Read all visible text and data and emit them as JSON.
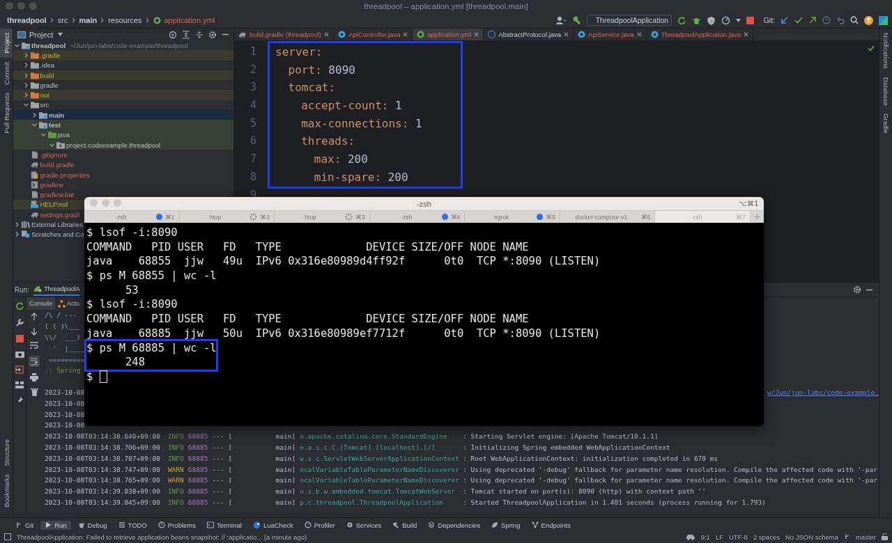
{
  "window": {
    "title": "threadpool – application.yml [threadpool.main]"
  },
  "breadcrumbs": [
    {
      "label": "threadpool",
      "untracked": false,
      "bold": true
    },
    {
      "label": "src",
      "untracked": false,
      "bold": false
    },
    {
      "label": "main",
      "untracked": false,
      "bold": true
    },
    {
      "label": "resources",
      "untracked": false,
      "bold": false
    },
    {
      "label": "application.yml",
      "untracked": true,
      "bold": false
    }
  ],
  "toolbar": {
    "run_config": "ThreadpoolApplication",
    "git_label": "Git:"
  },
  "left_stripe": {
    "top": [
      {
        "label": "Project",
        "selected": true
      },
      {
        "label": "Commit",
        "selected": false
      },
      {
        "label": "Pull Requests",
        "selected": false
      }
    ],
    "bottom": [
      {
        "label": "Structure",
        "selected": false
      },
      {
        "label": "Bookmarks",
        "selected": false
      }
    ]
  },
  "right_stripe": [
    {
      "label": "Notifications"
    },
    {
      "label": "Database"
    },
    {
      "label": "Gradle"
    }
  ],
  "project": {
    "title": "Project",
    "tree": [
      {
        "label": "threadpool",
        "hint": "~/Jun/jun-labs/code-example/threadpool",
        "kind": "module",
        "excluded": false,
        "untracked": false,
        "test_source": false,
        "selected": false,
        "expanded": true,
        "children": [
          {
            "label": ".gradle",
            "kind": "folder",
            "excluded": true,
            "untracked": false,
            "test_source": false,
            "selected": false,
            "expanded": false
          },
          {
            "label": ".idea",
            "kind": "folder",
            "excluded": false,
            "untracked": false,
            "test_source": false,
            "selected": false,
            "expanded": false
          },
          {
            "label": "build",
            "kind": "folder",
            "excluded": true,
            "untracked": false,
            "test_source": false,
            "selected": false,
            "expanded": false
          },
          {
            "label": "gradle",
            "kind": "folder",
            "excluded": false,
            "untracked": false,
            "test_source": false,
            "selected": false,
            "expanded": false
          },
          {
            "label": "out",
            "kind": "folder",
            "excluded": true,
            "untracked": false,
            "test_source": false,
            "selected": false,
            "expanded": false
          },
          {
            "label": "src",
            "kind": "folder",
            "excluded": false,
            "untracked": false,
            "test_source": false,
            "selected": false,
            "expanded": true,
            "children": [
              {
                "label": "main",
                "kind": "module",
                "excluded": false,
                "untracked": false,
                "test_source": false,
                "selected": true,
                "expanded": false
              },
              {
                "label": "test",
                "kind": "module",
                "excluded": false,
                "untracked": false,
                "test_source": true,
                "selected": false,
                "expanded": true,
                "children": [
                  {
                    "label": "java",
                    "kind": "test-folder",
                    "excluded": false,
                    "untracked": false,
                    "test_source": true,
                    "selected": false,
                    "expanded": true,
                    "children": [
                      {
                        "label": "project.codeexample.threadpool",
                        "kind": "package",
                        "excluded": false,
                        "untracked": false,
                        "test_source": true,
                        "selected": false,
                        "expanded": true
                      }
                    ]
                  }
                ]
              }
            ]
          },
          {
            "label": ".gitignore",
            "kind": "file",
            "excluded": false,
            "untracked": true,
            "test_source": false,
            "selected": false
          },
          {
            "label": "build.gradle",
            "kind": "gradle-file",
            "excluded": false,
            "untracked": true,
            "test_source": false,
            "selected": false
          },
          {
            "label": "gradle.properties",
            "kind": "properties-file",
            "excluded": false,
            "untracked": true,
            "test_source": false,
            "selected": false
          },
          {
            "label": "gradlew",
            "kind": "script-file",
            "excluded": false,
            "untracked": true,
            "test_source": false,
            "selected": false
          },
          {
            "label": "gradlew.bat",
            "kind": "file",
            "excluded": false,
            "untracked": true,
            "test_source": false,
            "selected": false
          },
          {
            "label": "HELP.md",
            "kind": "markdown-file",
            "excluded": true,
            "untracked": false,
            "test_source": false,
            "selected": false
          },
          {
            "label": "settings.gradl",
            "kind": "gradle-file",
            "excluded": false,
            "untracked": true,
            "test_source": false,
            "selected": false
          }
        ]
      },
      {
        "label": "External Libraries",
        "kind": "libraries",
        "excluded": false,
        "untracked": false,
        "test_source": false,
        "selected": false,
        "expanded": false
      },
      {
        "label": "Scratches and Co",
        "kind": "scratches",
        "excluded": false,
        "untracked": false,
        "test_source": false,
        "selected": false,
        "expanded": false
      }
    ]
  },
  "editor": {
    "tabs": [
      {
        "label": "build.gradle (threadpool)",
        "kind": "gradle",
        "untracked": true,
        "selected": false
      },
      {
        "label": "ApiController.java",
        "kind": "class",
        "untracked": true,
        "selected": false
      },
      {
        "label": "application.yml",
        "kind": "yaml",
        "untracked": true,
        "selected": true
      },
      {
        "label": "AbstractProtocol.java",
        "kind": "abstract",
        "untracked": false,
        "selected": false
      },
      {
        "label": "ApiService.java",
        "kind": "class",
        "untracked": true,
        "selected": false
      },
      {
        "label": "ThreadpoolApplication.java",
        "kind": "class",
        "untracked": true,
        "selected": false
      }
    ],
    "line_numbers": [
      "1",
      "2",
      "3",
      "4",
      "5",
      "6",
      "7",
      "8",
      "9"
    ],
    "highlighted": true,
    "code": [
      {
        "key": "server:",
        "children": [
          {
            "key": "port:",
            "value": "8090"
          },
          {
            "key": "tomcat:",
            "children": [
              {
                "key": "accept-count:",
                "value": "1"
              },
              {
                "key": "max-connections:",
                "value": "1"
              },
              {
                "key": "threads:",
                "children": [
                  {
                    "key": "max:",
                    "value": "200"
                  },
                  {
                    "key": "min-spare:",
                    "value": "200"
                  }
                ]
              }
            ]
          }
        ]
      }
    ]
  },
  "run": {
    "label": "Run:",
    "tab": "ThreadpoolA",
    "subtabs": [
      {
        "label": "Console",
        "selected": true
      },
      {
        "label": "Actu",
        "selected": false
      }
    ],
    "banner": [
      "/\\ / ---",
      "( ( )\\___",
      "\\\\/  ___)",
      "  '  |____",
      " =========",
      ":: Spring"
    ],
    "log": [
      {
        "time": "2023-10-08",
        "link": "w/Jun/jun-labs/code-example."
      },
      {
        "time": "2023-10-08"
      },
      {
        "time": "2023-10-08"
      },
      {
        "time": "2023-10-08"
      },
      {
        "time": "2023-10-08T03:14:38.640+09:00",
        "level": "INFO",
        "kind": "info",
        "pid": "68885",
        "dashes": "---",
        "open": "[",
        "thread": "main]",
        "logger": "o.apache.catalina.core.StandardEngine",
        "message": ": Starting Servlet engine: [Apache Tomcat/10.1.1]"
      },
      {
        "time": "2023-10-08T03:14:38.706+09:00",
        "level": "INFO",
        "kind": "info",
        "pid": "68885",
        "dashes": "---",
        "open": "[",
        "thread": "main]",
        "logger": "o.a.c.c.C.[Tomcat].[localhost].[/]",
        "message": ": Initializing Spring embedded WebApplicationContext"
      },
      {
        "time": "2023-10-08T03:14:38.707+09:00",
        "level": "INFO",
        "kind": "info",
        "pid": "68885",
        "dashes": "---",
        "open": "[",
        "thread": "main]",
        "logger": "w.s.c.ServletWebServerApplicationContext",
        "message": ": Root WebApplicationContext: initialization completed in 670 ms"
      },
      {
        "time": "2023-10-08T03:14:38.747+09:00",
        "level": "WARN",
        "kind": "warn",
        "pid": "68885",
        "dashes": "---",
        "open": "[",
        "thread": "main]",
        "logger": "ocalVariableTableParameterNameDiscoverer",
        "message": ": Using deprecated '-debug' fallback for parameter name resolution. Compile the affected code with '-par"
      },
      {
        "time": "2023-10-08T03:14:38.765+09:00",
        "level": "WARN",
        "kind": "warn",
        "pid": "68885",
        "dashes": "---",
        "open": "[",
        "thread": "main]",
        "logger": "ocalVariableTableParameterNameDiscoverer",
        "message": ": Using deprecated '-debug' fallback for parameter name resolution. Compile the affected code with '-par"
      },
      {
        "time": "2023-10-08T03:14:39.038+09:00",
        "level": "INFO",
        "kind": "info",
        "pid": "68885",
        "dashes": "---",
        "open": "[",
        "thread": "main]",
        "logger": "o.s.b.w.embedded.tomcat.TomcatWebServer",
        "message": ": Tomcat started on port(s): 8090 (http) with context path ''"
      },
      {
        "time": "2023-10-08T03:14:39.045+09:00",
        "level": "INFO",
        "kind": "info",
        "pid": "68885",
        "dashes": "---",
        "open": "[",
        "thread": "main]",
        "logger": "p.c.threadpool.ThreadpoolApplication",
        "message": ": Started ThreadpoolApplication in 1.401 seconds (process running for 1.793)"
      }
    ]
  },
  "tool_windows": [
    {
      "label": "Git",
      "kind": "git",
      "selected": false
    },
    {
      "label": "Run",
      "kind": "run",
      "selected": true
    },
    {
      "label": "Debug",
      "kind": "debug",
      "selected": false
    },
    {
      "label": "TODO",
      "kind": "list",
      "selected": false
    },
    {
      "label": "Problems",
      "kind": "problems",
      "selected": false
    },
    {
      "label": "Terminal",
      "kind": "terminal",
      "selected": false
    },
    {
      "label": "LuaCheck",
      "kind": "lua",
      "selected": false
    },
    {
      "label": "Profiler",
      "kind": "profiler",
      "selected": false
    },
    {
      "label": "Services",
      "kind": "services",
      "selected": false
    },
    {
      "label": "Build",
      "kind": "build",
      "selected": false
    },
    {
      "label": "Dependencies",
      "kind": "dependencies",
      "selected": false
    },
    {
      "label": "Spring",
      "kind": "spring",
      "selected": false
    },
    {
      "label": "Endpoints",
      "kind": "endpoints",
      "selected": false
    }
  ],
  "status_bar": {
    "message": "ThreadpoolApplication: Failed to retrieve application beans snapshot: // :applicatio... (a minute ago)",
    "items": [
      "9:1",
      "LF",
      "UTF-8",
      "2 spaces",
      "No JSON schema"
    ],
    "branch": "master"
  },
  "terminal": {
    "title": "-zsh",
    "shortcut": "⌥⌘1",
    "tabs": [
      {
        "label": "-zsh",
        "kind": "dot",
        "shortcut": "⌘1",
        "selected": false
      },
      {
        "label": "htop",
        "kind": "spinner",
        "shortcut": "⌘2",
        "selected": false
      },
      {
        "label": "htop",
        "kind": "spinner",
        "shortcut": "⌘3",
        "selected": false
      },
      {
        "label": "-zsh",
        "kind": "dot",
        "shortcut": "⌘4",
        "selected": false
      },
      {
        "label": "ngrok",
        "kind": "dot",
        "shortcut": "⌘5",
        "selected": false
      },
      {
        "label": "docker-compose-v1",
        "kind": "plain",
        "shortcut": "⌘6",
        "selected": false
      },
      {
        "label": "-zsh",
        "kind": "plain",
        "shortcut": "⌘7",
        "selected": true
      }
    ],
    "lines": [
      {
        "text": "$ lsof -i:8090",
        "highlighted": false
      },
      {
        "text": "COMMAND   PID USER   FD   TYPE             DEVICE SIZE/OFF NODE NAME",
        "highlighted": false
      },
      {
        "text": "java    68855  jjw   49u  IPv6 0x316e80989d4ff92f      0t0  TCP *:8090 (LISTEN)",
        "highlighted": false
      },
      {
        "text": "$ ps M 68855 | wc -l",
        "highlighted": false
      },
      {
        "text": "      53",
        "highlighted": false
      },
      {
        "text": "$ lsof -i:8090",
        "highlighted": false
      },
      {
        "text": "COMMAND   PID USER   FD   TYPE             DEVICE SIZE/OFF NODE NAME",
        "highlighted": false
      },
      {
        "text": "java    68885  jjw   50u  IPv6 0x316e80989ef7712f      0t0  TCP *:8090 (LISTEN)",
        "highlighted": false
      },
      {
        "text": "$ ps M 68885 | wc -l",
        "highlighted": true
      },
      {
        "text": "      248",
        "highlighted": true
      },
      {
        "text": "$",
        "highlighted": false,
        "cursor": true
      }
    ]
  }
}
